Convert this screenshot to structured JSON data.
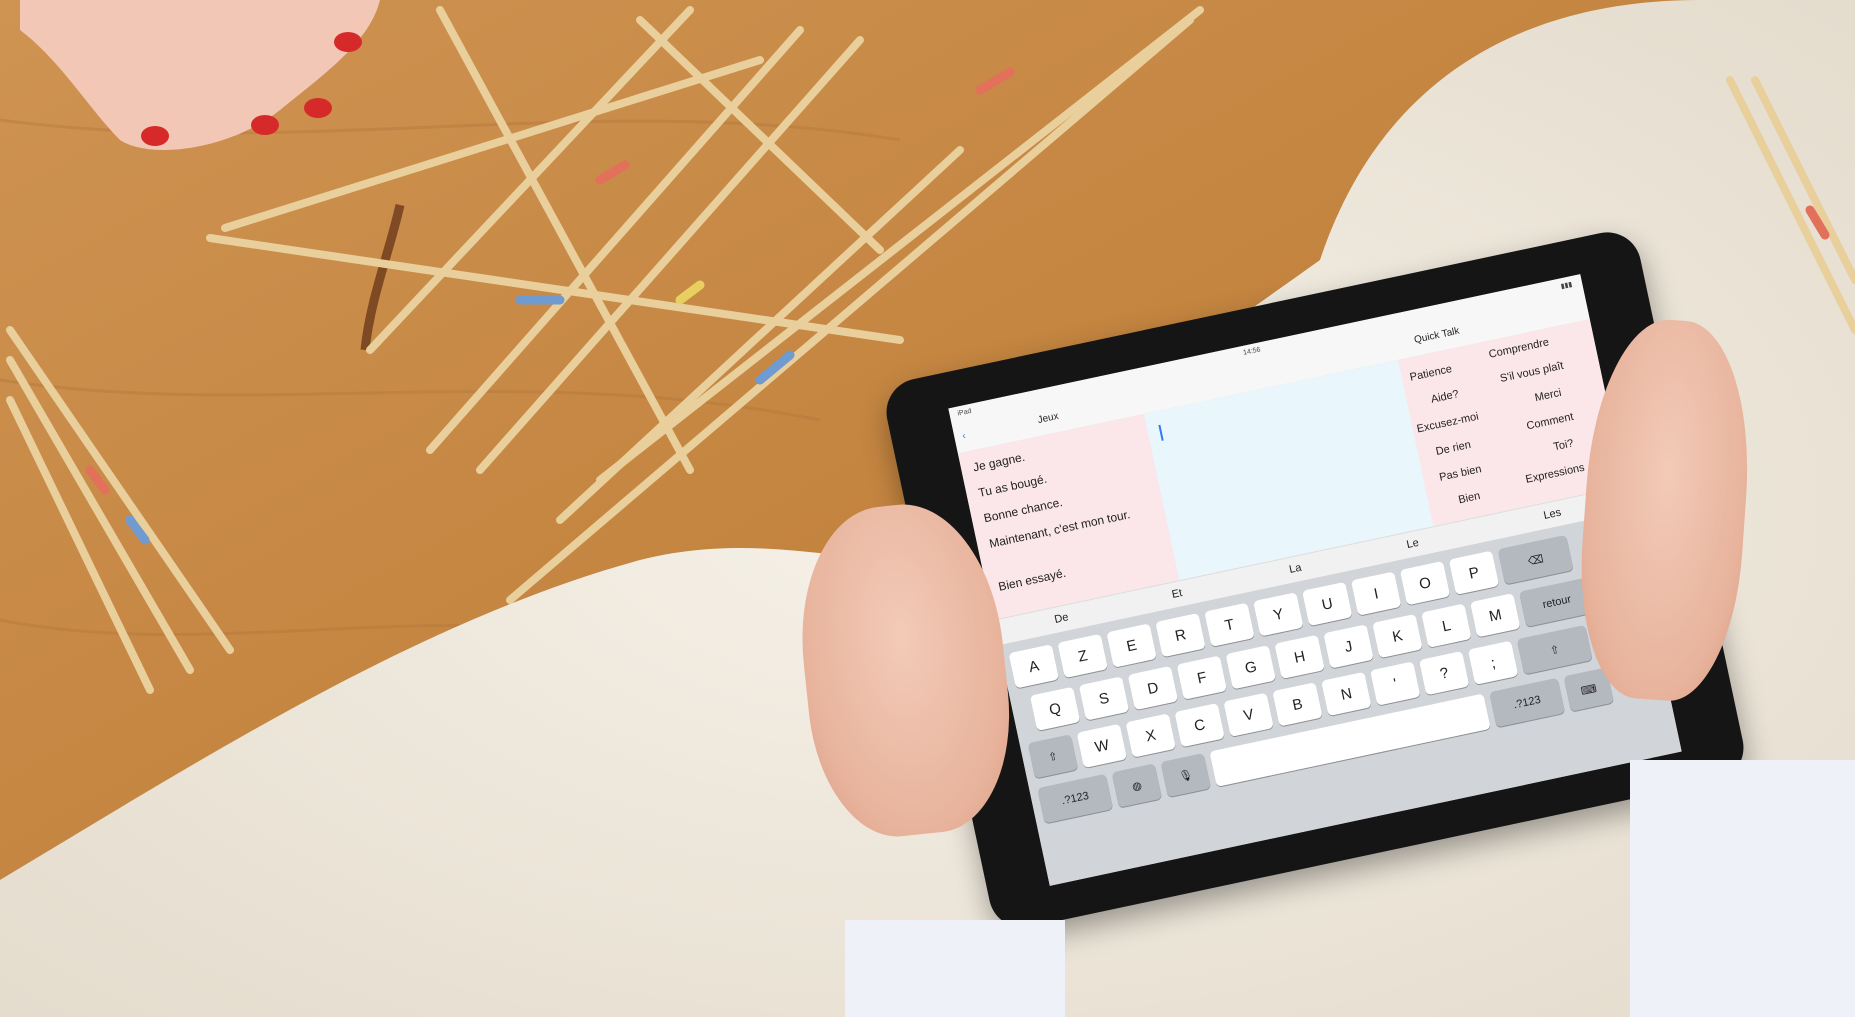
{
  "colors": {
    "wood": "#c98a4a",
    "rug": "#f3eee6",
    "tablet_frame": "#151515",
    "ios_blue": "#2f7cf6",
    "panel_pink": "#fbe7ea",
    "editor_blue": "#e9f6fb",
    "keyboard_bg": "#d1d4d9",
    "nail_polish": "#d62a2a"
  },
  "tablet": {
    "nav": {
      "back_label": "‹",
      "category_title": "Jeux",
      "quicktalk_title": "Quick Talk"
    },
    "phrases": [
      "Je gagne.",
      "Tu as bougé.",
      "Bonne chance.",
      "Maintenant, c'est mon tour.",
      "Bien essayé."
    ],
    "quick_words": [
      "Patience",
      "Comprendre",
      "Aide?",
      "S'il vous plaît",
      "Excusez-moi",
      "Merci",
      "De rien",
      "Comment",
      "Pas bien",
      "Toi?",
      "Bien",
      "Expressions"
    ],
    "suggestions": [
      "De",
      "Et",
      "La",
      "Le",
      "Les"
    ],
    "keyboard": {
      "row1": [
        "A",
        "Z",
        "E",
        "R",
        "T",
        "Y",
        "U",
        "I",
        "O",
        "P"
      ],
      "row2": [
        "Q",
        "S",
        "D",
        "F",
        "G",
        "H",
        "J",
        "K",
        "L",
        "M"
      ],
      "row3": [
        "W",
        "X",
        "C",
        "V",
        "B",
        "N",
        "'",
        "?",
        ";"
      ],
      "return_label": "retour",
      "numbers_label": ".?123"
    }
  }
}
